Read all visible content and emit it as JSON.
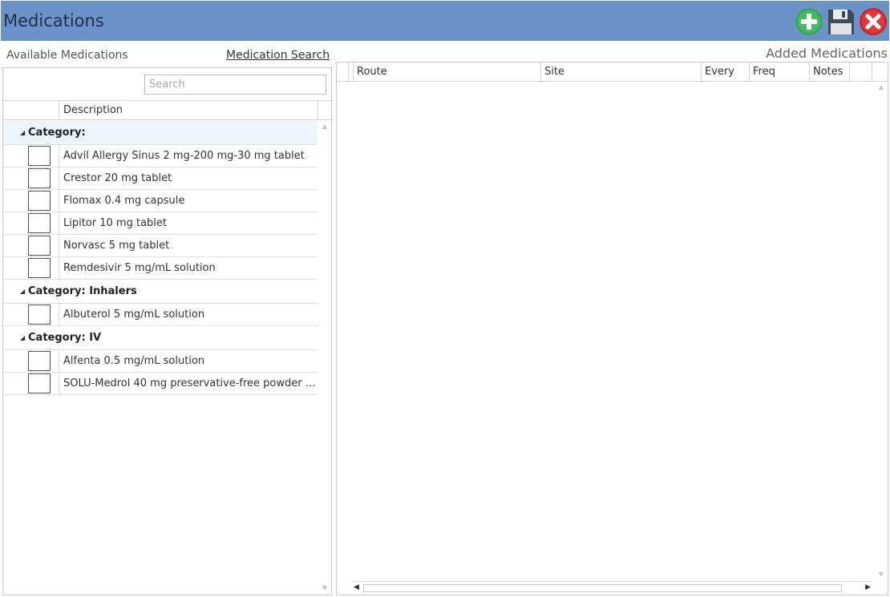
{
  "window": {
    "title": "Medications",
    "accent_color": "#6b93c7",
    "toolbar": {
      "add_icon": "plus-circle-icon",
      "save_icon": "floppy-disk-icon",
      "close_icon": "close-x-icon"
    }
  },
  "left": {
    "heading": "Available Medications",
    "search_link": "Medication Search",
    "search_placeholder": "Search",
    "column_description": "Description",
    "groups": [
      {
        "label": "Category:",
        "items": [
          "Advil Allergy Sinus 2 mg-200 mg-30 mg tablet",
          "Crestor 20 mg tablet",
          "Flomax 0.4 mg capsule",
          "Lipitor 10 mg tablet",
          "Norvasc 5 mg tablet",
          "Remdesivir 5 mg/mL solution"
        ]
      },
      {
        "label": "Category: Inhalers",
        "items": [
          "Albuterol 5 mg/mL solution"
        ]
      },
      {
        "label": "Category: IV",
        "items": [
          "Alfenta 0.5 mg/mL solution",
          "SOLU-Medrol 40 mg preservative-free powder fo..."
        ]
      }
    ]
  },
  "right": {
    "heading": "Added Medications",
    "columns": {
      "route": "Route",
      "site": "Site",
      "every": "Every",
      "freq": "Freq",
      "notes": "Notes"
    }
  }
}
